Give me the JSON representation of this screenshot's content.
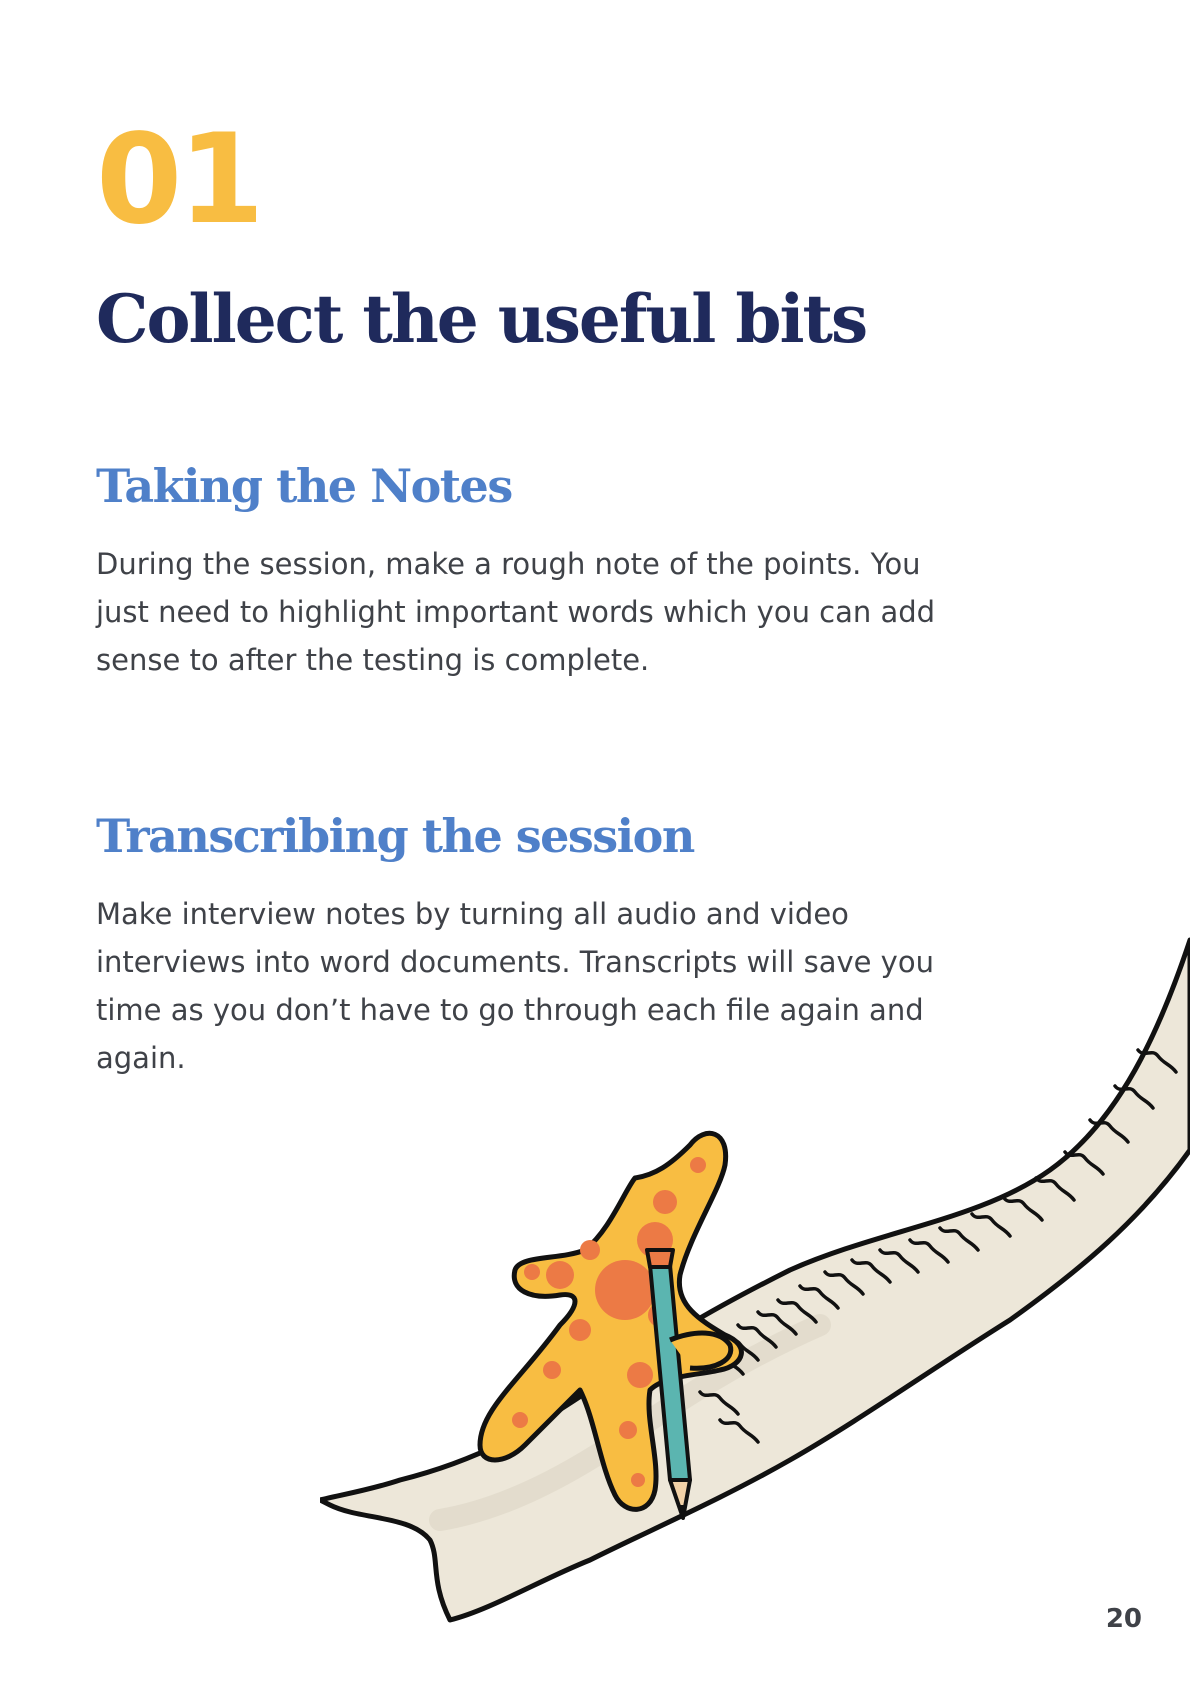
{
  "page": {
    "number_label": "01",
    "title": "Collect the useful bits",
    "page_number": "20"
  },
  "sections": [
    {
      "heading": "Taking the Notes",
      "body": "During the session, make a rough note of the points. You just need to highlight important words which you can add sense to after the testing is complete."
    },
    {
      "heading": "Transcribing the session",
      "body": "Make interview notes by turning all audio and video interviews into word documents. Transcripts will save you time as you don’t have to go through each file again and again."
    }
  ],
  "colors": {
    "number": "#F8BD42",
    "title": "#1F2A5C",
    "heading": "#4F80C9",
    "body": "#3F4248",
    "scroll_paper": "#EDE7D9",
    "starfish": "#F8BD42",
    "starfish_spots": "#EC7A45",
    "pencil": "#5BB5B0"
  },
  "illustration": {
    "name": "starfish-writing-on-scroll-illustration"
  }
}
